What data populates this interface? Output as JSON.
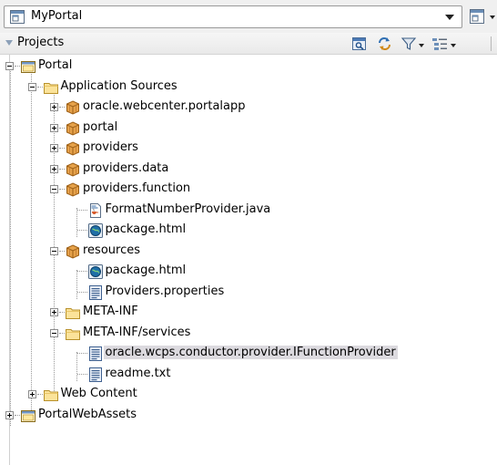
{
  "app_selector": {
    "value": "MyPortal",
    "icon": "application-icon",
    "menu_icon": "application-menu-icon"
  },
  "projects_panel": {
    "title": "Projects",
    "toolbar": [
      {
        "icon": "project-properties-icon"
      },
      {
        "icon": "refresh-icon"
      },
      {
        "icon": "filter-icon",
        "has_dropdown": true
      },
      {
        "icon": "working-sets-icon",
        "has_dropdown": true
      }
    ]
  },
  "tree": [
    {
      "label": "Portal",
      "icon": "project-icon",
      "state": "expanded"
    },
    {
      "label": "Application Sources",
      "icon": "folder-icon",
      "state": "expanded"
    },
    {
      "label": "oracle.webcenter.portalapp",
      "icon": "package-icon",
      "state": "collapsed"
    },
    {
      "label": "portal",
      "icon": "package-icon",
      "state": "collapsed"
    },
    {
      "label": "providers",
      "icon": "package-icon",
      "state": "collapsed"
    },
    {
      "label": "providers.data",
      "icon": "package-icon",
      "state": "collapsed"
    },
    {
      "label": "providers.function",
      "icon": "package-icon",
      "state": "expanded"
    },
    {
      "label": "FormatNumberProvider.java",
      "icon": "java-file-icon",
      "state": "leaf"
    },
    {
      "label": "package.html",
      "icon": "html-file-icon",
      "state": "leaf"
    },
    {
      "label": "resources",
      "icon": "package-icon",
      "state": "expanded"
    },
    {
      "label": "package.html",
      "icon": "html-file-icon",
      "state": "leaf"
    },
    {
      "label": "Providers.properties",
      "icon": "text-file-icon",
      "state": "leaf"
    },
    {
      "label": "META-INF",
      "icon": "folder-icon",
      "state": "collapsed"
    },
    {
      "label": "META-INF/services",
      "icon": "folder-icon",
      "state": "expanded"
    },
    {
      "label": "oracle.wcps.conductor.provider.IFunctionProvider",
      "icon": "text-file-icon",
      "state": "leaf",
      "selected": true
    },
    {
      "label": "readme.txt",
      "icon": "text-file-icon",
      "state": "leaf"
    },
    {
      "label": "Web Content",
      "icon": "folder-icon",
      "state": "collapsed"
    },
    {
      "label": "PortalWebAssets",
      "icon": "project-icon",
      "state": "collapsed"
    }
  ]
}
